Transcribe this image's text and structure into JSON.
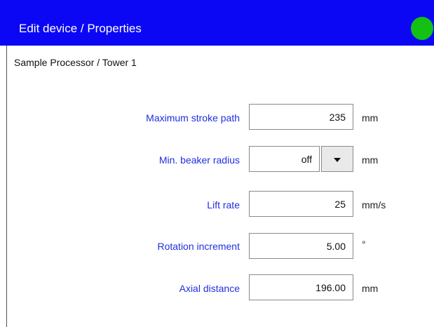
{
  "window": {
    "title": "Edit device / Properties",
    "status_color": "#14c014",
    "header_color": "#0b07f5"
  },
  "device": {
    "path": "Sample Processor / Tower 1"
  },
  "fields": {
    "max_stroke": {
      "label": "Maximum stroke path",
      "value": "235",
      "unit": "mm"
    },
    "min_beaker_radius": {
      "label": "Min. beaker radius",
      "value": "off",
      "unit": "mm"
    },
    "lift_rate": {
      "label": "Lift rate",
      "value": "25",
      "unit": "mm/s"
    },
    "rotation_increment": {
      "label": "Rotation increment",
      "value": "5.00",
      "unit": "°"
    },
    "axial_distance": {
      "label": "Axial distance",
      "value": "196.00",
      "unit": "mm"
    }
  },
  "icons": {
    "status": "status-light-icon",
    "dropdown": "chevron-down-icon"
  },
  "colors": {
    "label": "#1f2fe0",
    "text": "#111111"
  }
}
